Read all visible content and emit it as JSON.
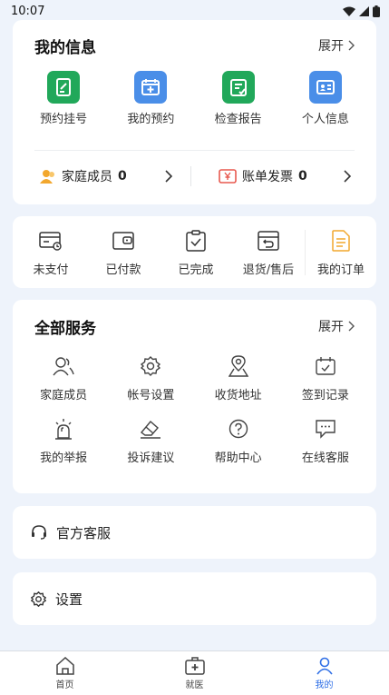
{
  "status_bar": {
    "time": "10:07"
  },
  "my_info": {
    "title": "我的信息",
    "expand_label": "展开",
    "items": [
      {
        "label": "预约挂号",
        "icon": "edit-document-icon",
        "color": "#21a85a"
      },
      {
        "label": "我的预约",
        "icon": "calendar-plus-icon",
        "color": "#4a8ee8"
      },
      {
        "label": "检查报告",
        "icon": "report-check-icon",
        "color": "#21a85a"
      },
      {
        "label": "个人信息",
        "icon": "id-card-icon",
        "color": "#4a8ee8"
      }
    ],
    "family": {
      "label": "家庭成员",
      "count": "0"
    },
    "bills": {
      "label": "账单发票",
      "count": "0"
    }
  },
  "orders": {
    "items": [
      {
        "label": "未支付",
        "icon": "unpaid-icon"
      },
      {
        "label": "已付款",
        "icon": "wallet-icon"
      },
      {
        "label": "已完成",
        "icon": "clipboard-check-icon"
      },
      {
        "label": "退货/售后",
        "icon": "return-box-icon"
      }
    ],
    "my_orders_label": "我的订单"
  },
  "services": {
    "title": "全部服务",
    "expand_label": "展开",
    "items": [
      {
        "label": "家庭成员",
        "icon": "family-icon"
      },
      {
        "label": "帐号设置",
        "icon": "gear-icon"
      },
      {
        "label": "收货地址",
        "icon": "map-pin-icon"
      },
      {
        "label": "签到记录",
        "icon": "calendar-check-icon"
      },
      {
        "label": "我的举报",
        "icon": "alarm-light-icon"
      },
      {
        "label": "投诉建议",
        "icon": "eraser-icon"
      },
      {
        "label": "帮助中心",
        "icon": "help-icon"
      },
      {
        "label": "在线客服",
        "icon": "chat-icon"
      }
    ]
  },
  "official_service": {
    "label": "官方客服"
  },
  "settings": {
    "label": "设置"
  },
  "tabbar": {
    "items": [
      {
        "label": "首页"
      },
      {
        "label": "就医"
      },
      {
        "label": "我的"
      }
    ],
    "active_color": "#2f6fe6"
  }
}
